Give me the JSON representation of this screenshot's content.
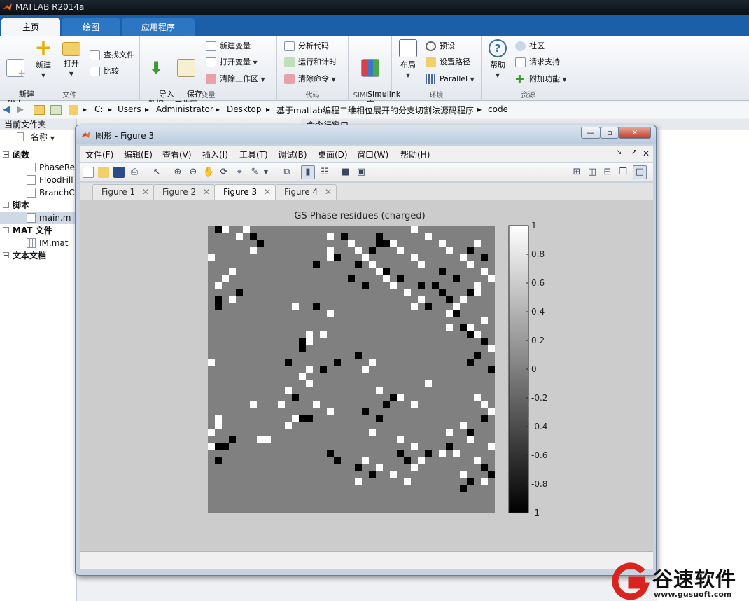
{
  "app": {
    "title": "MATLAB R2014a"
  },
  "ribbon_tabs": [
    "主页",
    "绘图",
    "应用程序"
  ],
  "ribbon": {
    "file_group": {
      "label": "文件",
      "new_script": "新建\n脚本",
      "new": "新建",
      "open": "打开",
      "find_files": "查找文件",
      "compare": "比较"
    },
    "variable_group": {
      "label": "变量",
      "import_data": "导入\n数据",
      "save_workspace": "保存\n工作区",
      "new_variable": "新建变量",
      "open_variable": "打开变量",
      "clear_workspace": "清除工作区"
    },
    "code_group": {
      "label": "代码",
      "analyze_code": "分析代码",
      "run_and_time": "运行和计时",
      "clear_commands": "清除命令"
    },
    "simulink_group": {
      "label": "SIMULINK",
      "simulink_library": "Simulink\n库"
    },
    "env_group": {
      "label": "环境",
      "layout": "布局",
      "preferences": "预设",
      "set_path": "设置路径",
      "parallel": "Parallel"
    },
    "resources_group": {
      "label": "资源",
      "help": "帮助",
      "community": "社区",
      "request_support": "请求支持",
      "add_ons": "附加功能"
    }
  },
  "address_bar": {
    "crumbs": [
      "C:",
      "Users",
      "Administrator",
      "Desktop",
      "基于matlab编程二维相位展开的分支切割法源码程序",
      "code"
    ]
  },
  "current_folder": {
    "title": "当前文件夹",
    "column": "名称",
    "sections": [
      {
        "name": "函数",
        "items": [
          "PhaseRe",
          "FloodFill",
          "BranchC"
        ]
      },
      {
        "name": "脚本",
        "items": [
          "main.m"
        ]
      },
      {
        "name": "MAT 文件",
        "items": [
          "IM.mat"
        ]
      },
      {
        "name": "文本文档",
        "items": []
      }
    ]
  },
  "command_window": {
    "title": "命令行窗口"
  },
  "figure_window": {
    "title": "图形 - Figure 3",
    "menu": [
      "文件(F)",
      "编辑(E)",
      "查看(V)",
      "插入(I)",
      "工具(T)",
      "调试(B)",
      "桌面(D)",
      "窗口(W)",
      "帮助(H)"
    ],
    "tabs": [
      "Figure 1",
      "Figure 2",
      "Figure 3",
      "Figure 4"
    ],
    "active_tab": "Figure 3"
  },
  "chart_data": {
    "type": "heatmap",
    "title": "GS Phase residues (charged)",
    "grid_size": [
      41,
      41
    ],
    "clim": [
      -1,
      1
    ],
    "colormap": "gray",
    "colorbar_ticks": [
      "1",
      "0.8",
      "0.6",
      "0.4",
      "0.2",
      "0",
      "-0.2",
      "-0.4",
      "-0.6",
      "-0.8",
      "-1"
    ],
    "positive_cells": [
      [
        0,
        2
      ],
      [
        0,
        5
      ],
      [
        1,
        4
      ],
      [
        3,
        6
      ],
      [
        4,
        0
      ],
      [
        4,
        17
      ],
      [
        6,
        3
      ],
      [
        7,
        2
      ],
      [
        8,
        1
      ],
      [
        10,
        3
      ],
      [
        12,
        17
      ],
      [
        15,
        14
      ],
      [
        16,
        14
      ],
      [
        19,
        0
      ],
      [
        20,
        14
      ],
      [
        21,
        13
      ],
      [
        22,
        14
      ],
      [
        23,
        11
      ],
      [
        25,
        10
      ],
      [
        25,
        6
      ],
      [
        27,
        1
      ],
      [
        29,
        0
      ],
      [
        28,
        1
      ],
      [
        31,
        0
      ],
      [
        30,
        7
      ],
      [
        3,
        17
      ],
      [
        15,
        16
      ],
      [
        11,
        12
      ],
      [
        1,
        17
      ],
      [
        0,
        29
      ],
      [
        2,
        20
      ],
      [
        3,
        21
      ],
      [
        4,
        22
      ],
      [
        5,
        23
      ],
      [
        6,
        24
      ],
      [
        2,
        26
      ],
      [
        3,
        27
      ],
      [
        4,
        29
      ],
      [
        5,
        30
      ],
      [
        7,
        25
      ],
      [
        8,
        26
      ],
      [
        9,
        28
      ],
      [
        10,
        30
      ],
      [
        11,
        29
      ],
      [
        2,
        33
      ],
      [
        3,
        34
      ],
      [
        4,
        36
      ],
      [
        5,
        37
      ],
      [
        6,
        39
      ],
      [
        7,
        40
      ],
      [
        8,
        38
      ],
      [
        10,
        36
      ],
      [
        11,
        35
      ],
      [
        12,
        34
      ],
      [
        13,
        39
      ],
      [
        14,
        37
      ],
      [
        15,
        38
      ],
      [
        17,
        40
      ],
      [
        22,
        31
      ],
      [
        24,
        38
      ],
      [
        25,
        39
      ],
      [
        26,
        40
      ],
      [
        28,
        36
      ],
      [
        29,
        34
      ],
      [
        30,
        37
      ],
      [
        31,
        40
      ],
      [
        32,
        35
      ],
      [
        33,
        38
      ],
      [
        35,
        36
      ],
      [
        36,
        39
      ],
      [
        33,
        22
      ],
      [
        34,
        24
      ],
      [
        35,
        26
      ],
      [
        36,
        28
      ],
      [
        34,
        29
      ],
      [
        33,
        30
      ],
      [
        32,
        33
      ],
      [
        31,
        29
      ],
      [
        30,
        27
      ],
      [
        29,
        23
      ],
      [
        25,
        29
      ],
      [
        24,
        27
      ],
      [
        23,
        24
      ],
      [
        20,
        22
      ],
      [
        19,
        23
      ],
      [
        26,
        17
      ],
      [
        25,
        15
      ],
      [
        30,
        8
      ],
      [
        27,
        12
      ],
      [
        28,
        11
      ],
      [
        36,
        21
      ],
      [
        1,
        31
      ],
      [
        2,
        38
      ],
      [
        14,
        34
      ],
      [
        9,
        38
      ]
    ],
    "negative_cells": [
      [
        0,
        1
      ],
      [
        1,
        6
      ],
      [
        2,
        7
      ],
      [
        9,
        4
      ],
      [
        10,
        1
      ],
      [
        11,
        1
      ],
      [
        16,
        13
      ],
      [
        17,
        13
      ],
      [
        19,
        18
      ],
      [
        24,
        12
      ],
      [
        27,
        14
      ],
      [
        31,
        2
      ],
      [
        31,
        1
      ],
      [
        30,
        3
      ],
      [
        33,
        1
      ],
      [
        27,
        13
      ],
      [
        1,
        19
      ],
      [
        1,
        24
      ],
      [
        2,
        24
      ],
      [
        2,
        25
      ],
      [
        3,
        23
      ],
      [
        4,
        18
      ],
      [
        5,
        21
      ],
      [
        6,
        25
      ],
      [
        7,
        27
      ],
      [
        8,
        30
      ],
      [
        9,
        33
      ],
      [
        10,
        34
      ],
      [
        11,
        31
      ],
      [
        12,
        35
      ],
      [
        1,
        19
      ],
      [
        3,
        37
      ],
      [
        4,
        39
      ],
      [
        6,
        33
      ],
      [
        7,
        35
      ],
      [
        8,
        32
      ],
      [
        9,
        37
      ],
      [
        14,
        36
      ],
      [
        15,
        37
      ],
      [
        16,
        39
      ],
      [
        18,
        38
      ],
      [
        19,
        37
      ],
      [
        20,
        40
      ],
      [
        27,
        39
      ],
      [
        29,
        37
      ],
      [
        31,
        34
      ],
      [
        32,
        31
      ],
      [
        34,
        39
      ],
      [
        35,
        40
      ],
      [
        36,
        37
      ],
      [
        37,
        36
      ],
      [
        27,
        24
      ],
      [
        26,
        22
      ],
      [
        25,
        25
      ],
      [
        24,
        26
      ],
      [
        32,
        17
      ],
      [
        33,
        18
      ],
      [
        34,
        21
      ],
      [
        35,
        23
      ],
      [
        33,
        28
      ],
      [
        34,
        29
      ],
      [
        32,
        27
      ],
      [
        19,
        11
      ],
      [
        20,
        16
      ],
      [
        18,
        21
      ],
      [
        5,
        15
      ],
      [
        7,
        20
      ],
      [
        8,
        22
      ],
      [
        11,
        15
      ]
    ]
  }
}
